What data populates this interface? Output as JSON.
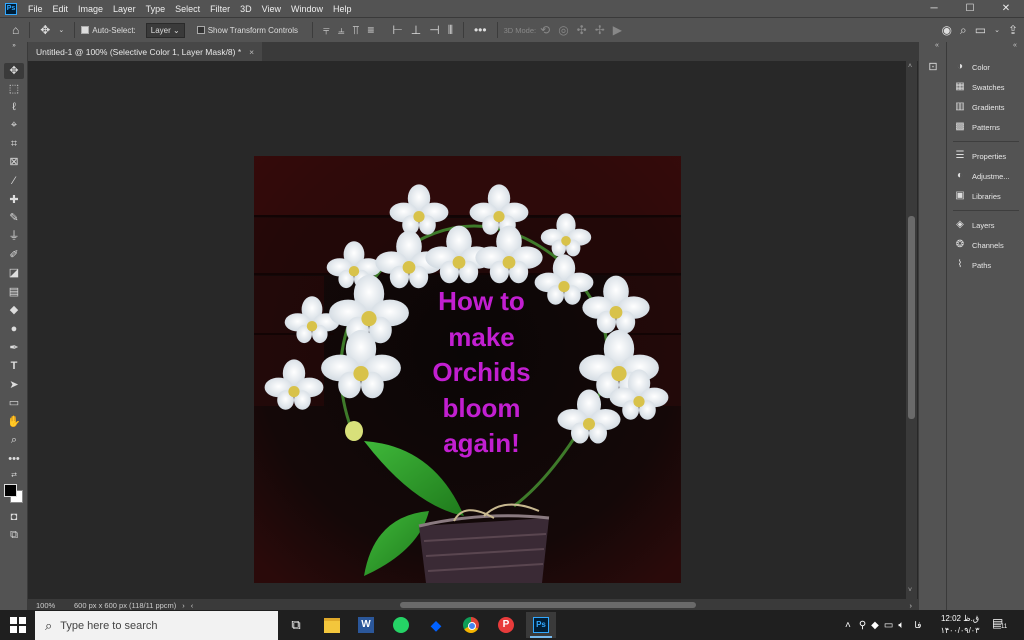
{
  "menubar": {
    "app_logo": "Ps",
    "items": [
      "File",
      "Edit",
      "Image",
      "Layer",
      "Type",
      "Select",
      "Filter",
      "3D",
      "View",
      "Window",
      "Help"
    ]
  },
  "options_bar": {
    "auto_select_label": "Auto-Select:",
    "auto_select_checked": true,
    "auto_select_target": "Layer",
    "transform_controls_label": "Show Transform Controls",
    "mode_3d_label": "3D Mode:"
  },
  "document": {
    "tab_title": "Untitled-1 @ 100% (Selective Color 1, Layer Mask/8) *",
    "close_glyph": "×",
    "overlay_text": [
      "How to",
      "make",
      "Orchids",
      "bloom",
      "again!"
    ],
    "overlay_color": "#c21fd1"
  },
  "status": {
    "zoom": "100%",
    "doc_info": "600 px x 600 px (118/11 ppcm)"
  },
  "panels": {
    "group1": [
      "Color",
      "Swatches",
      "Gradients",
      "Patterns"
    ],
    "group2": [
      "Properties",
      "Adjustme...",
      "Libraries"
    ],
    "group3": [
      "Layers",
      "Channels",
      "Paths"
    ]
  },
  "taskbar": {
    "search_placeholder": "Type here to search",
    "lang": "فا",
    "time": "12:02 ق.ظ",
    "date": "۱۴۰۰/۰۹/۰۳",
    "notification_count": "11"
  },
  "colors": {
    "panel_bg": "#535353",
    "canvas_bg": "#282828",
    "accent": "#31a8ff"
  }
}
